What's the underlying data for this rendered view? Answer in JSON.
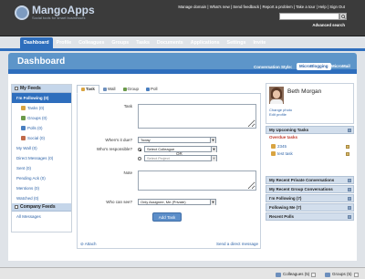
{
  "brand": {
    "name": "MangoApps",
    "tagline": "Social tools for smart businesses"
  },
  "toplinks": {
    "user": "Manage domain",
    "sep1": " | ",
    "whats_new": "What's new",
    "send_feedback": "Send feedback",
    "report": "Report a problem",
    "tour": "Take a tour",
    "help": "Help",
    "signout": "Sign Out"
  },
  "search": {
    "placeholder": "",
    "advanced": "Advanced search"
  },
  "nav": [
    "Dashboard",
    "Profile",
    "Colleagues",
    "Groups",
    "Tasks",
    "Documents",
    "Applications",
    "Settings",
    "Invite"
  ],
  "page": {
    "title": "Dashboard",
    "conv_style_label": "Conversation Style:",
    "style_micro": "MicroBlogging",
    "style_mail": "MicroMail"
  },
  "left": {
    "my_feeds": "My Feeds",
    "following": "I'm Following (0)",
    "items": [
      "Tasks (0)",
      "Groups (0)",
      "Polls (0)",
      "Social (0)"
    ],
    "more": [
      "My Wall (0)",
      "Direct Messages (0)",
      "Sent (0)",
      "Pending Ack (0)",
      "Mentions (0)",
      "Watched (0)"
    ],
    "company_feeds": "Company Feeds",
    "all_messages": "All Messages"
  },
  "composer": {
    "tabs": [
      "Task",
      "Wall",
      "Group",
      "Poll"
    ],
    "task_label": "Task",
    "due_label": "When's it due?",
    "due_value": "Today",
    "resp_label": "Who's responsible?",
    "resp_value": "Select Colleague",
    "or": "OR",
    "project_value": "Select Project",
    "note_label": "Note",
    "see_label": "Who can see?",
    "see_value": "Only Assignee, Me (Private)",
    "add_button": "Add Task",
    "attach": "Attach",
    "send_dm": "Send a direct message"
  },
  "profile": {
    "name": "Beth Morgan",
    "change_photo": "Change photo",
    "edit_profile": "Edit profile"
  },
  "right": {
    "upcoming": "My Upcoming Tasks",
    "overdue": "Overdue tasks",
    "tasks": [
      "2345",
      "test task"
    ],
    "sections": [
      "My Recent Private Conversations",
      "My Recent Group Conversations",
      "I'm Following (7)",
      "Following Me (7)",
      "Recent Polls"
    ]
  },
  "statusbar": {
    "colleagues": "Colleagues (5)",
    "groups": "Groups (5)"
  }
}
